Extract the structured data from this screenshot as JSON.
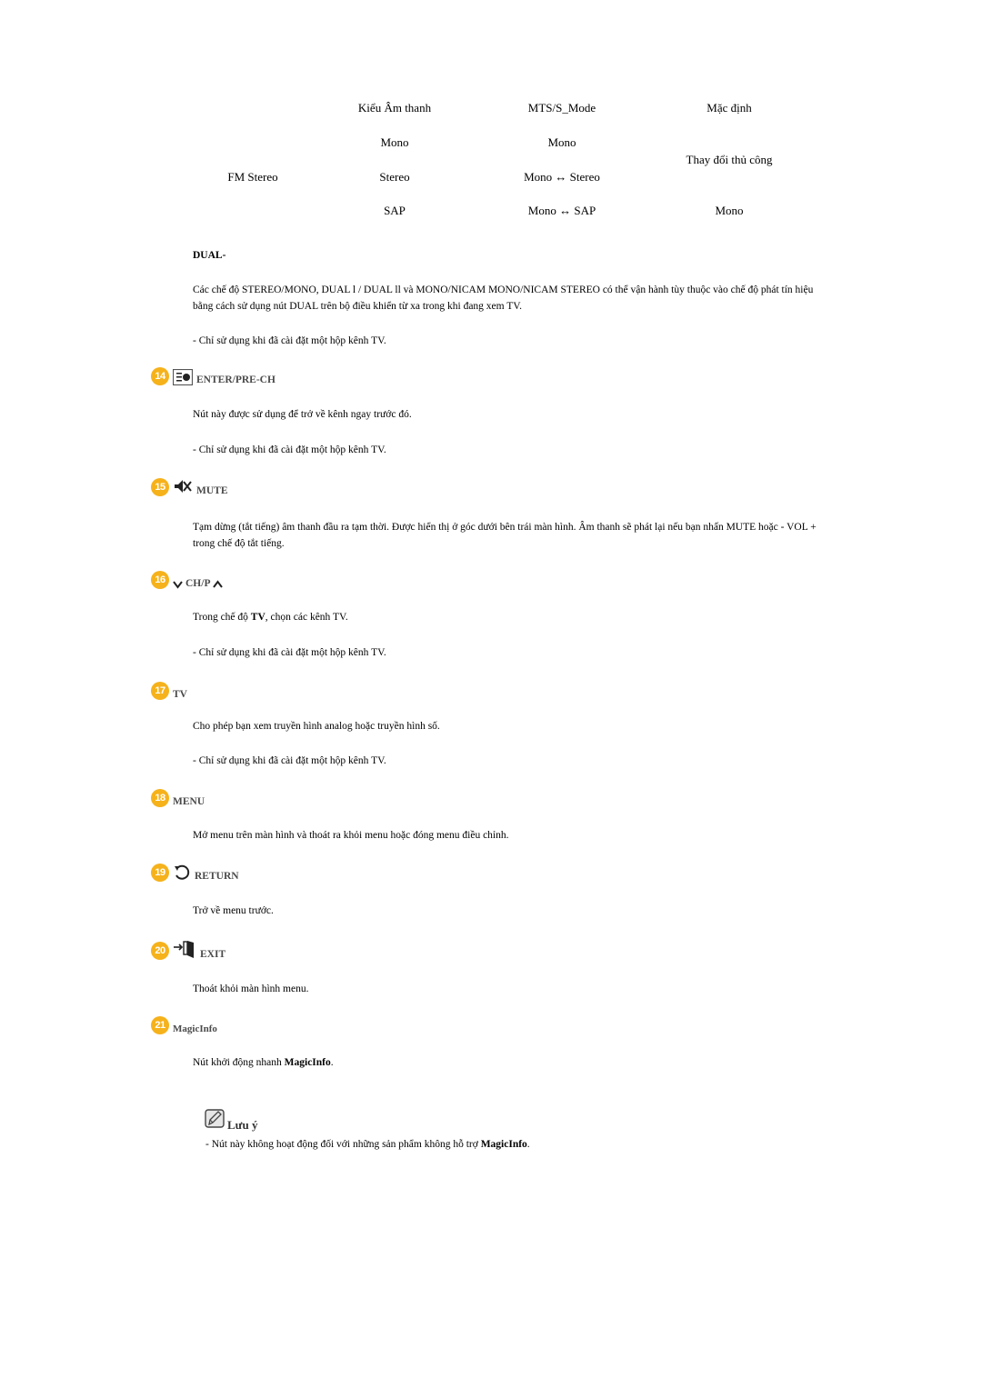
{
  "table": {
    "headers": [
      "Kiểu Âm thanh",
      "MTS/S_Mode",
      "Mặc định"
    ],
    "row_group_label": "FM Stereo",
    "rows": [
      {
        "type": "Mono",
        "mode": "Mono"
      },
      {
        "type": "Stereo",
        "mode": "Mono ↔ Stereo"
      },
      {
        "type": "SAP",
        "mode": "Mono ↔ SAP",
        "default": "Mono"
      }
    ],
    "merged_default": "Thay đổi thủ công"
  },
  "dual": {
    "title": "DUAL-",
    "description": "Các chế độ STEREO/MONO, DUAL l / DUAL ll và MONO/NICAM MONO/NICAM STEREO có thể vận hành tùy thuộc vào chế độ phát tín hiệu bằng cách sử dụng nút DUAL trên bộ điều khiển từ xa trong khi đang xem TV.",
    "note": "- Chỉ sử dụng khi đã cài đặt một hộp kênh TV."
  },
  "sections": [
    {
      "number": "14",
      "icon": "enter-pre-ch-icon",
      "title": "ENTER/PRE-CH",
      "text": "Nút này được sử dụng để trở về kênh ngay trước đó.",
      "note": "- Chỉ sử dụng khi đã cài đặt một hộp kênh TV."
    },
    {
      "number": "15",
      "icon": "mute-icon",
      "title": "MUTE",
      "text": "Tạm dừng (tắt tiếng) âm thanh đầu ra tạm thời. Được hiển thị ở góc dưới bên trái màn hình. Âm thanh sẽ phát lại nếu bạn nhấn MUTE hoặc - VOL + trong chế độ tắt tiếng."
    },
    {
      "number": "16",
      "icon": "chevron-icons",
      "title": "CH/P",
      "text_pre": "Trong chế độ ",
      "text_bold": "TV",
      "text_post": ", chọn các kênh TV.",
      "note": "- Chỉ sử dụng khi đã cài đặt một hộp kênh TV."
    },
    {
      "number": "17",
      "title": "TV",
      "text": "Cho phép bạn xem truyền hình analog hoặc truyền hình số.",
      "note": "- Chỉ sử dụng khi đã cài đặt một hộp kênh TV."
    },
    {
      "number": "18",
      "title": "MENU",
      "text": "Mở menu trên màn hình và thoát ra khỏi menu hoặc đóng menu điều chỉnh."
    },
    {
      "number": "19",
      "icon": "return-icon",
      "title": "RETURN",
      "text": "Trở về menu trước."
    },
    {
      "number": "20",
      "icon": "exit-icon",
      "title": "EXIT",
      "text": "Thoát khỏi màn hình menu."
    },
    {
      "number": "21",
      "title": "MagicInfo",
      "text_pre": "Nút khởi động nhanh ",
      "text_bold": "MagicInfo",
      "text_post": "."
    }
  ],
  "note_box": {
    "label": "Lưu ý",
    "text_pre": "- Nút này không hoạt động đối với những sản phẩm không hỗ trợ ",
    "text_bold": "MagicInfo",
    "text_post": "."
  },
  "colors": {
    "badge": "#f6b21b",
    "heading": "#4a4a4a"
  }
}
